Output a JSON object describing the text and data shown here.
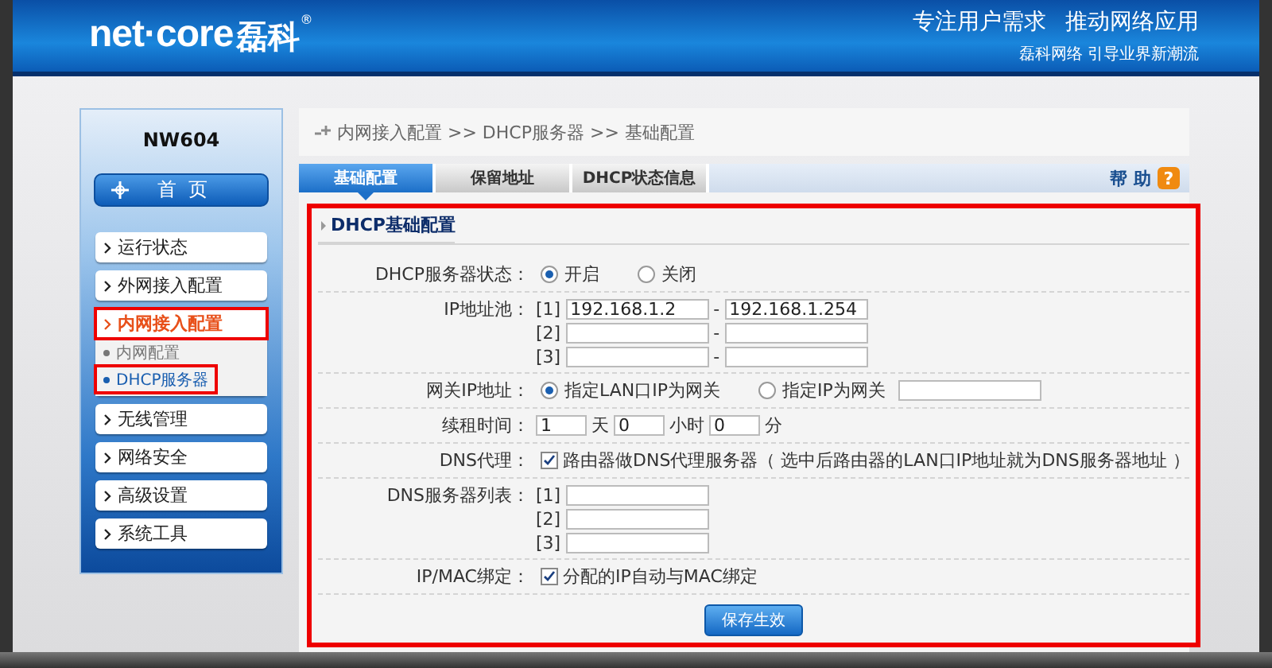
{
  "header": {
    "logo": "net·core",
    "logo_cn": "磊科",
    "reg": "®",
    "slogan": [
      "专注用户需求",
      "推动网络应用"
    ],
    "tagline": "磊科网络 引导业界新潮流"
  },
  "sidebar": {
    "model": "NW604",
    "home": "首  页",
    "items": [
      {
        "label": "运行状态",
        "expanded": false,
        "highlighted": false
      },
      {
        "label": "外网接入配置",
        "expanded": false,
        "highlighted": false
      },
      {
        "label": "内网接入配置",
        "expanded": true,
        "highlighted": true,
        "children": [
          {
            "label": "内网配置",
            "selected": false,
            "highlighted": false
          },
          {
            "label": "DHCP服务器",
            "selected": true,
            "highlighted": true
          }
        ]
      },
      {
        "label": "无线管理",
        "expanded": false,
        "highlighted": false
      },
      {
        "label": "网络安全",
        "expanded": false,
        "highlighted": false
      },
      {
        "label": "高级设置",
        "expanded": false,
        "highlighted": false
      },
      {
        "label": "系统工具",
        "expanded": false,
        "highlighted": false
      }
    ]
  },
  "breadcrumb": "内网接入配置 >> DHCP服务器 >> 基础配置",
  "tabs": [
    {
      "label": "基础配置",
      "selected": true
    },
    {
      "label": "保留地址",
      "selected": false
    },
    {
      "label": "DHCP状态信息",
      "selected": false
    }
  ],
  "help": {
    "label": "帮 助",
    "icon_text": "?"
  },
  "form": {
    "title": "DHCP基础配置",
    "highlighted": true,
    "rows": [
      {
        "kind": "radio",
        "label": "DHCP服务器状态：",
        "options": [
          {
            "label": "开启",
            "selected": true,
            "field": false
          },
          {
            "label": "关闭",
            "selected": false,
            "field": false
          }
        ]
      },
      {
        "kind": "range",
        "label": "IP地址池：",
        "entries": [
          {
            "index": "[1]",
            "start": "192.168.1.2",
            "separator": "-",
            "end": "192.168.1.254"
          },
          {
            "index": "[2]",
            "separator": "-"
          },
          {
            "index": "[3]",
            "separator": "-"
          }
        ]
      },
      {
        "kind": "radio",
        "label": "网关IP地址：",
        "options": [
          {
            "label": "指定LAN口IP为网关",
            "selected": true,
            "field": false
          },
          {
            "label": "指定IP为网关",
            "selected": false,
            "field": true
          }
        ]
      },
      {
        "kind": "lease",
        "label": "续租时间：",
        "parts": [
          {
            "value": "1",
            "unit": "天"
          },
          {
            "value": "0",
            "unit": "小时"
          },
          {
            "value": "0",
            "unit": "分"
          }
        ]
      },
      {
        "kind": "checkbox",
        "label": "DNS代理：",
        "checked": true,
        "text": "路由器做DNS代理服务器（ 选中后路由器的LAN口IP地址就为DNS服务器地址 ）"
      },
      {
        "kind": "list",
        "label": "DNS服务器列表：",
        "entries": [
          {
            "index": "[1]"
          },
          {
            "index": "[2]"
          },
          {
            "index": "[3]"
          }
        ]
      },
      {
        "kind": "checkbox",
        "label": "IP/MAC绑定：",
        "checked": true,
        "text": "分配的IP自动与MAC绑定"
      }
    ],
    "button": "保存生效"
  }
}
